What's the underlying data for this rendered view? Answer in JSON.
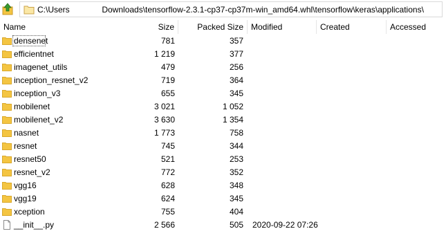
{
  "path": {
    "value": "C:\\Users              Downloads\\tensorflow-2.3.1-cp37-cp37m-win_amd64.whl\\tensorflow\\keras\\applications\\"
  },
  "columns": {
    "name": "Name",
    "size": "Size",
    "packed": "Packed Size",
    "modified": "Modified",
    "created": "Created",
    "accessed": "Accessed"
  },
  "files": [
    {
      "name": "densenet",
      "size": "781",
      "packed": "357",
      "modified": "",
      "icon": "folder-icon"
    },
    {
      "name": "efficientnet",
      "size": "1 219",
      "packed": "377",
      "modified": "",
      "icon": "folder-icon"
    },
    {
      "name": "imagenet_utils",
      "size": "479",
      "packed": "256",
      "modified": "",
      "icon": "folder-icon"
    },
    {
      "name": "inception_resnet_v2",
      "size": "719",
      "packed": "364",
      "modified": "",
      "icon": "folder-icon"
    },
    {
      "name": "inception_v3",
      "size": "655",
      "packed": "345",
      "modified": "",
      "icon": "folder-icon"
    },
    {
      "name": "mobilenet",
      "size": "3 021",
      "packed": "1 052",
      "modified": "",
      "icon": "folder-icon"
    },
    {
      "name": "mobilenet_v2",
      "size": "3 630",
      "packed": "1 354",
      "modified": "",
      "icon": "folder-icon"
    },
    {
      "name": "nasnet",
      "size": "1 773",
      "packed": "758",
      "modified": "",
      "icon": "folder-icon"
    },
    {
      "name": "resnet",
      "size": "745",
      "packed": "344",
      "modified": "",
      "icon": "folder-icon"
    },
    {
      "name": "resnet50",
      "size": "521",
      "packed": "253",
      "modified": "",
      "icon": "folder-icon"
    },
    {
      "name": "resnet_v2",
      "size": "772",
      "packed": "352",
      "modified": "",
      "icon": "folder-icon"
    },
    {
      "name": "vgg16",
      "size": "628",
      "packed": "348",
      "modified": "",
      "icon": "folder-icon"
    },
    {
      "name": "vgg19",
      "size": "624",
      "packed": "345",
      "modified": "",
      "icon": "folder-icon"
    },
    {
      "name": "xception",
      "size": "755",
      "packed": "404",
      "modified": "",
      "icon": "folder-icon"
    },
    {
      "name": "__init__.py",
      "size": "2 566",
      "packed": "505",
      "modified": "2020-09-22 07:26",
      "icon": "file-icon"
    }
  ],
  "colors": {
    "folder": "#f4c542",
    "folder_dark": "#d9a82b",
    "up_arrow": "#3a9a2e"
  }
}
